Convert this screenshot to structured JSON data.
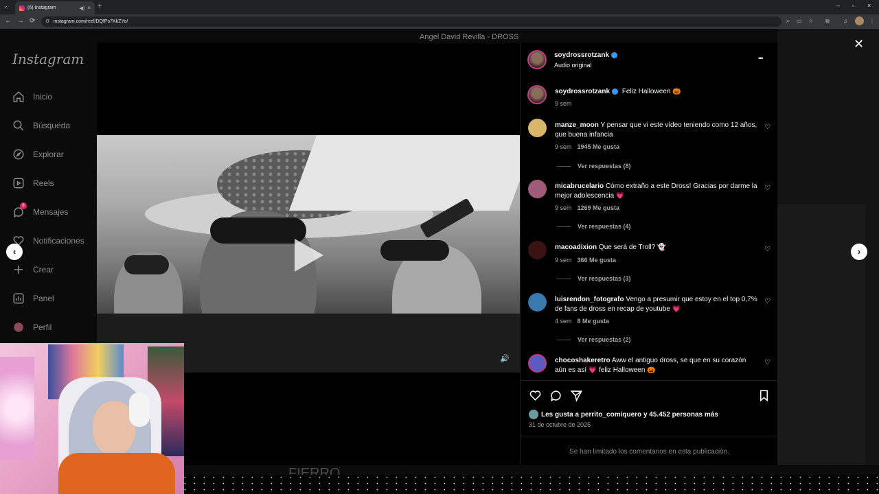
{
  "browser": {
    "tab_title": "(6) Instagram",
    "url": "instagram.com/reel/DQfPs7KkZYo/",
    "new_tab": "+",
    "tab_close": "×",
    "tab_menu": "⌄",
    "back": "←",
    "forward": "→",
    "reload": "⟳",
    "minimize": "–",
    "maximize": "▫",
    "close": "×"
  },
  "background": {
    "video_title": "Angel David Revilla - DROSS",
    "lower_text": "FIERRO"
  },
  "sidebar": {
    "logo": "Instagram",
    "items": [
      {
        "label": "Inicio",
        "icon": "home-icon"
      },
      {
        "label": "Búsqueda",
        "icon": "search-icon"
      },
      {
        "label": "Explorar",
        "icon": "compass-icon"
      },
      {
        "label": "Reels",
        "icon": "reels-icon"
      },
      {
        "label": "Mensajes",
        "icon": "messenger-icon",
        "badge": "6"
      },
      {
        "label": "Notificaciones",
        "icon": "heart-icon"
      },
      {
        "label": "Crear",
        "icon": "plus-icon"
      },
      {
        "label": "Panel",
        "icon": "chart-icon"
      },
      {
        "label": "Perfil",
        "icon": "avatar-icon"
      }
    ]
  },
  "post": {
    "author": "soydrossrotzank",
    "audio": "Audio original",
    "more": "•••",
    "caption": {
      "author": "soydrossrotzank",
      "text": "Feliz Halloween 🎃",
      "time": "9 sem"
    },
    "comments": [
      {
        "user": "manze_moon",
        "text": "Y pensar que vi este vídeo teniendo como 12 años, que buena infancia",
        "time": "9 sem",
        "likes": "1945 Me gusta",
        "replies": "Ver respuestas (8)",
        "avatar_color": "#d9b66a"
      },
      {
        "user": "micabrucelario",
        "text": "Cómo extraño a este Dross! Gracias por darme la mejor adolescencia 💗",
        "time": "9 sem",
        "likes": "1269 Me gusta",
        "replies": "Ver respuestas (4)",
        "avatar_color": "#a05a7a"
      },
      {
        "user": "macoadixion",
        "text": "Que será de Troll? 👻",
        "time": "9 sem",
        "likes": "366 Me gusta",
        "replies": "Ver respuestas (3)",
        "avatar_color": "#3a1414"
      },
      {
        "user": "luisrendon_fotografo",
        "text": "Vengo a presumir que estoy en el top 0,7% de fans de dross en recap de youtube 💗",
        "time": "4 sem",
        "likes": "8 Me gusta",
        "replies": "Ver respuestas (2)",
        "avatar_color": "#3a78b0"
      },
      {
        "user": "chocoshakeretro",
        "text": "Aww el antiguo dross, se que en su corazón aún es así 💗 feliz Halloween 🎃",
        "time": "",
        "likes": "",
        "replies": "",
        "avatar_color": "#5a5ac0"
      }
    ],
    "likes_prefix": "Les gusta a ",
    "likes_user": "perrito_comiquero",
    "likes_suffix": " y 45.452 personas más",
    "date": "31 de octubre de 2025",
    "comments_limited": "Se han limitado los comentarios en esta publicación."
  },
  "overlay": {
    "close": "✕",
    "prev": "‹",
    "next": "›",
    "volume": "🔊"
  }
}
